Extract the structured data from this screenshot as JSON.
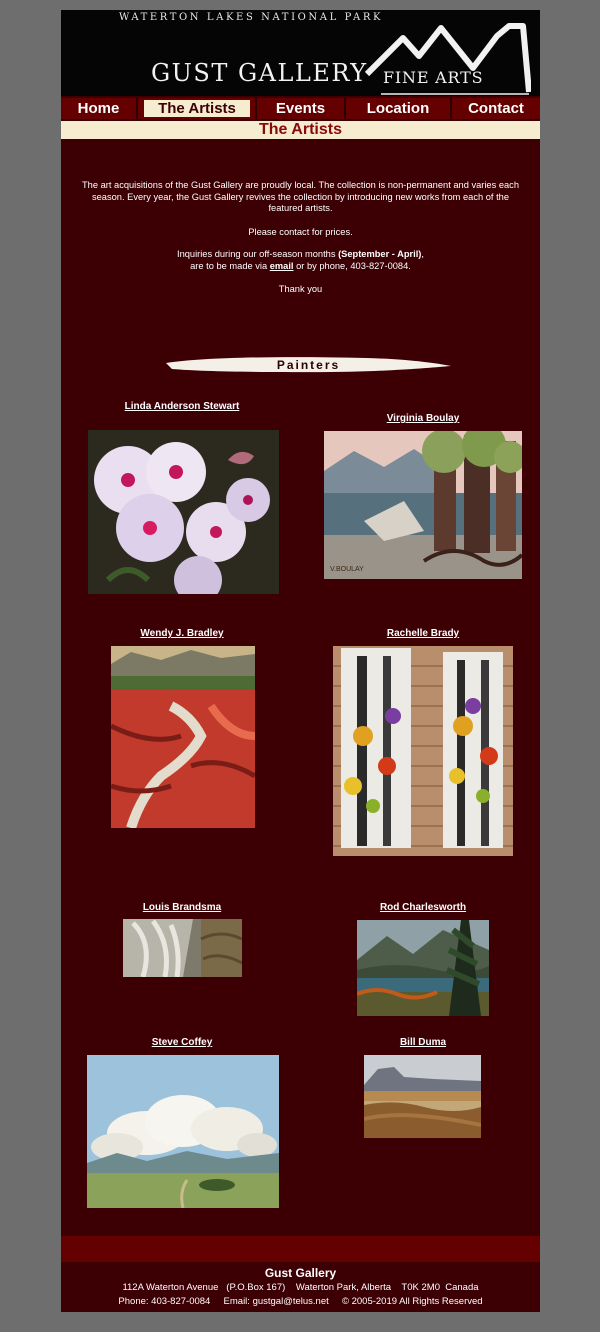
{
  "header": {
    "park": "WATERTON LAKES NATIONAL PARK",
    "gallery_name": "GUST GALLERY",
    "fine_arts": "FINE ARTS"
  },
  "nav": [
    {
      "label": "Home"
    },
    {
      "label": "The Artists"
    },
    {
      "label": "Events"
    },
    {
      "label": "Location"
    },
    {
      "label": "Contact"
    }
  ],
  "page_title": "The Artists",
  "intro": {
    "paragraph": "The art acquisitions of the Gust Gallery are proudly local. The collection is non-permanent and varies each season. Every year, the Gust Gallery revives the collection by introducing new works from each of the featured artists.",
    "prices": "Please contact for prices.",
    "inquiries_pre": "Inquiries during our off-season months ",
    "months": "(September - April)",
    "inquiries_mid": "are to be made via ",
    "email_link": "email",
    "inquiries_post": " or by phone, 403-827-0084.",
    "thanks": "Thank you"
  },
  "section_title": "Painters",
  "artists": [
    {
      "name": "Linda Anderson Stewart",
      "art_icon": "flowers-painting"
    },
    {
      "name": "Virginia Boulay",
      "art_icon": "trees-lake-painting",
      "signature": "V.BOULAY"
    },
    {
      "name": "Wendy J. Bradley",
      "art_icon": "red-rock-canyon-painting"
    },
    {
      "name": "Rachelle Brady",
      "art_icon": "birch-trees-painting"
    },
    {
      "name": "Louis Brandsma",
      "art_icon": "waterfall-painting"
    },
    {
      "name": "Rod Charlesworth",
      "art_icon": "mountain-lake-painting"
    },
    {
      "name": "Steve Coffey",
      "art_icon": "prairie-clouds-painting"
    },
    {
      "name": "Bill Duma",
      "art_icon": "chief-mountain-painting"
    }
  ],
  "footer": {
    "name": "Gust Gallery",
    "address": "112A Waterton Avenue   (P.O.Box 167)    Waterton Park, Alberta    T0K 2M0  Canada",
    "contact": "Phone: 403-827-0084     Email: gustgal@telus.net     © 2005-2019 All Rights Reserved"
  },
  "colors": {
    "page_bg": "#6e6e6e",
    "content_bg": "#3c0004",
    "nav_bg": "#650000",
    "title_bar": "#f6eccf",
    "title_text": "#8a0a0a"
  }
}
